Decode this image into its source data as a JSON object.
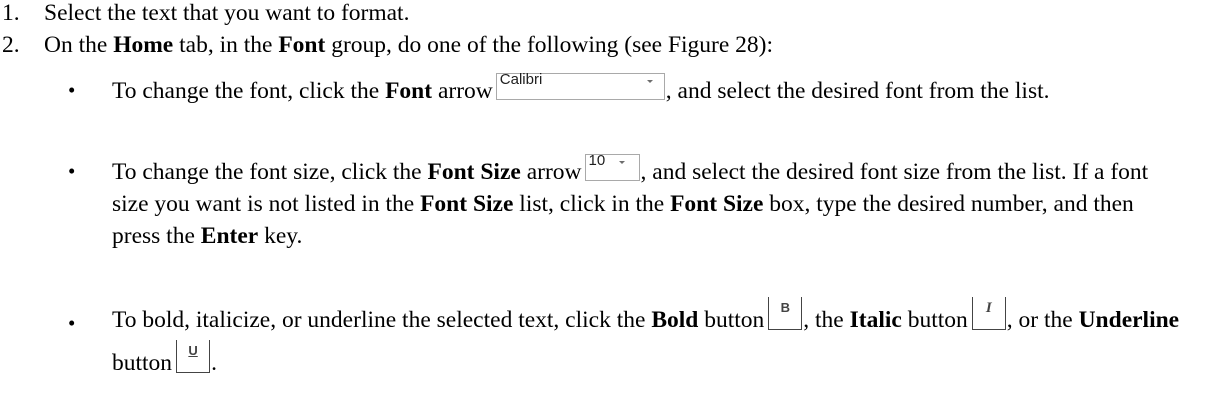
{
  "steps": [
    {
      "number": "1.",
      "segments": [
        {
          "text": "Select the text that you want to format.",
          "bold": false
        }
      ]
    },
    {
      "number": "2.",
      "segments": [
        {
          "text": "On the ",
          "bold": false
        },
        {
          "text": "Home",
          "bold": true
        },
        {
          "text": " tab, in the ",
          "bold": false
        },
        {
          "text": "Font",
          "bold": true
        },
        {
          "text": " group, do one of the following (see Figure 28):",
          "bold": false
        }
      ]
    }
  ],
  "bullet_marker": "•",
  "bullets": {
    "font": {
      "pre": "To change the font, click the ",
      "name": "Font",
      "mid": " arrow",
      "post": ", and select the desired font from the list.",
      "control_value": "Calibri"
    },
    "size": {
      "pre": "To change the font size, click the ",
      "name": "Font Size",
      "mid": " arrow",
      "post1": ", and select the desired font size from the list. If a font size you want is not listed in the ",
      "name2": "Font Size",
      "post2": " list, click in the ",
      "name3": "Font Size",
      "post3": " box, type the desired number, and then press the ",
      "key": "Enter",
      "post4": " key.",
      "control_value": "10"
    },
    "style": {
      "pre": "To bold, italicize, or underline the selected text, click the ",
      "bold_name": "Bold",
      "bold_mid": " button",
      "sep1": ", the ",
      "italic_name": "Italic",
      "italic_mid": " button",
      "sep2": ", or the ",
      "underline_name": "Underline",
      "underline_mid": " button",
      "end": ".",
      "bold_glyph": "B",
      "italic_glyph": "I",
      "underline_glyph": "U"
    }
  }
}
